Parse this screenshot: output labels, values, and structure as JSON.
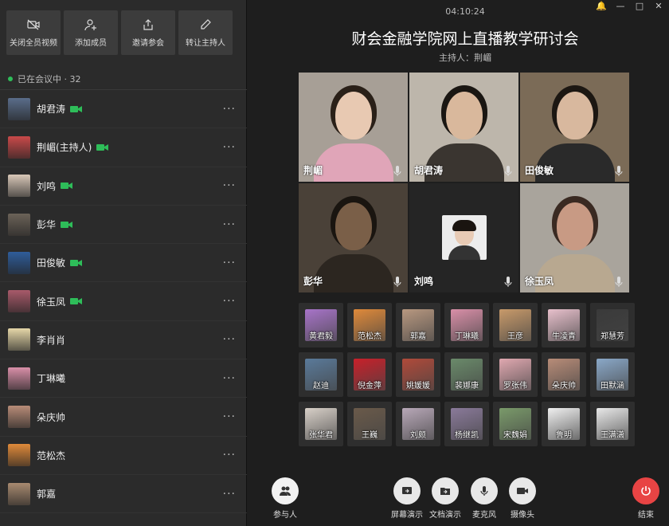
{
  "toolbar": [
    {
      "label": "关闭全员视频",
      "icon": "video-off-icon"
    },
    {
      "label": "添加成员",
      "icon": "add-user-icon"
    },
    {
      "label": "邀请参会",
      "icon": "share-icon"
    },
    {
      "label": "转让主持人",
      "icon": "pen-icon"
    }
  ],
  "members_header": "已在会议中 · 32",
  "members": [
    {
      "name": "胡君涛",
      "cam": true,
      "color": "#5a6d8a"
    },
    {
      "name": "荆嵋(主持人)",
      "cam": true,
      "color": "#c94a4a"
    },
    {
      "name": "刘鸣",
      "cam": true,
      "color": "#d9c8b8"
    },
    {
      "name": "彭华",
      "cam": true,
      "color": "#6b6258"
    },
    {
      "name": "田俊敏",
      "cam": true,
      "color": "#2f5d9a"
    },
    {
      "name": "徐玉凤",
      "cam": true,
      "color": "#a85a6a"
    },
    {
      "name": "李肖肖",
      "cam": false,
      "color": "#e6d7a8"
    },
    {
      "name": "丁琳曦",
      "cam": false,
      "color": "#d98fa8"
    },
    {
      "name": "朵庆帅",
      "cam": false,
      "color": "#b88c78"
    },
    {
      "name": "范松杰",
      "cam": false,
      "color": "#e08a3a"
    },
    {
      "name": "郭嘉",
      "cam": false,
      "color": "#a88a70"
    }
  ],
  "window": {
    "clock": "04:10:24",
    "title": "财会金融学院网上直播教学研讨会",
    "host": "主持人：荆嵋"
  },
  "videos": [
    {
      "name": "荆嵋",
      "bg": "#a79f96",
      "shirt": "#e0a5b8",
      "face": "#e8c9b2",
      "hair": "#2a2018"
    },
    {
      "name": "胡君涛",
      "bg": "#bdb6ab",
      "shirt": "#3a3530",
      "face": "#d9b89c",
      "hair": "#1a1612"
    },
    {
      "name": "田俊敏",
      "bg": "#7b6b57",
      "shirt": "#2a2a2a",
      "face": "#d8b89e",
      "hair": "#1c1712"
    },
    {
      "name": "彭华",
      "bg": "#4a4138",
      "shirt": "#2c2620",
      "face": "#7a5f48",
      "hair": "#1a1510"
    },
    {
      "name": "刘鸣",
      "bg": "#252525",
      "shirt": "#222",
      "face": "#e8cbb5",
      "hair": "#1a1410"
    },
    {
      "name": "徐玉凤",
      "bg": "#a9a49c",
      "shirt": "#b8a890",
      "face": "#c89a84",
      "hair": "#3a2a22"
    }
  ],
  "thumbs": [
    {
      "name": "黄君毅",
      "color": "#a874c9"
    },
    {
      "name": "范松杰",
      "color": "#e08a3a"
    },
    {
      "name": "郭嘉",
      "color": "#b89880"
    },
    {
      "name": "丁琳曦",
      "color": "#d98fa8"
    },
    {
      "name": "王彦",
      "color": "#c89a6a"
    },
    {
      "name": "牛凌青",
      "color": "#e8c0cc"
    },
    {
      "name": "郑慧芳",
      "color": "#3a3a3a"
    },
    {
      "name": "赵迪",
      "color": "#5a7a9a"
    },
    {
      "name": "倪金萍",
      "color": "#c8202a"
    },
    {
      "name": "姚媛媛",
      "color": "#b04a3a"
    },
    {
      "name": "裴娜康",
      "color": "#6a8a6a"
    },
    {
      "name": "罗张伟",
      "color": "#e0a8b0"
    },
    {
      "name": "朵庆帅",
      "color": "#b88c78"
    },
    {
      "name": "田默涵",
      "color": "#8aa8c8"
    },
    {
      "name": "张华君",
      "color": "#d8d0c8"
    },
    {
      "name": "王巍",
      "color": "#6a5a4a"
    },
    {
      "name": "刘颇",
      "color": "#b8a8b8"
    },
    {
      "name": "杨继凯",
      "color": "#8a7a9a"
    },
    {
      "name": "宋魏娟",
      "color": "#7a9a6a"
    },
    {
      "name": "鲁明",
      "color": "#f0f0f0"
    },
    {
      "name": "王满潇",
      "color": "#e8e8e8"
    }
  ],
  "bottom": {
    "participants": "参与人",
    "screen_share": "屏幕演示",
    "doc_share": "文档演示",
    "mic": "麦克风",
    "camera": "摄像头",
    "end": "结束"
  }
}
